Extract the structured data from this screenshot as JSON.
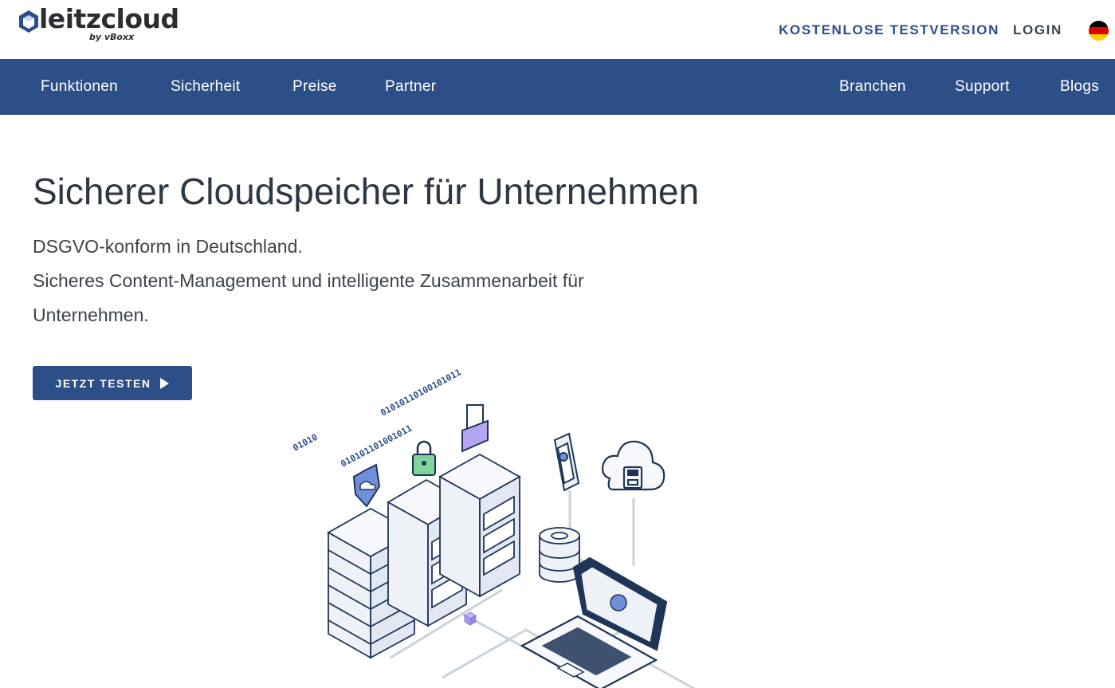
{
  "brand": {
    "name": "leitzcloud",
    "byline": "by vBoxx",
    "icon": "hexagon-cube-logo-icon"
  },
  "top_links": {
    "trial": "KOSTENLOSE TESTVERSION",
    "login": "LOGIN",
    "language_icon": "german-flag-icon"
  },
  "nav": {
    "left": [
      "Funktionen",
      "Sicherheit",
      "Preise",
      "Partner"
    ],
    "right": [
      "Branchen",
      "Support",
      "Blogs"
    ]
  },
  "hero": {
    "title": "Sicherer Cloudspeicher für Unternehmen",
    "subtitle_lines": [
      "DSGVO-konform in Deutschland.",
      "Sicheres Content-Management und intelligente Zusammenarbeit für",
      "Unternehmen."
    ],
    "cta_label": "JETZT TESTEN",
    "cta_icon": "play-triangle-icon"
  },
  "illustration": {
    "binary_strings": [
      "01010",
      "01010110100101011",
      "010101101001011"
    ],
    "icons": [
      "shield-icon",
      "padlock-icon",
      "document-folder-icon",
      "server-rack-icon",
      "database-icon",
      "smartphone-icon",
      "cloud-icon",
      "laptop-icon"
    ]
  },
  "colors": {
    "primary": "#2d4f88",
    "text": "#2e3845",
    "flag": [
      "#000000",
      "#dd0000",
      "#ffce00"
    ]
  }
}
